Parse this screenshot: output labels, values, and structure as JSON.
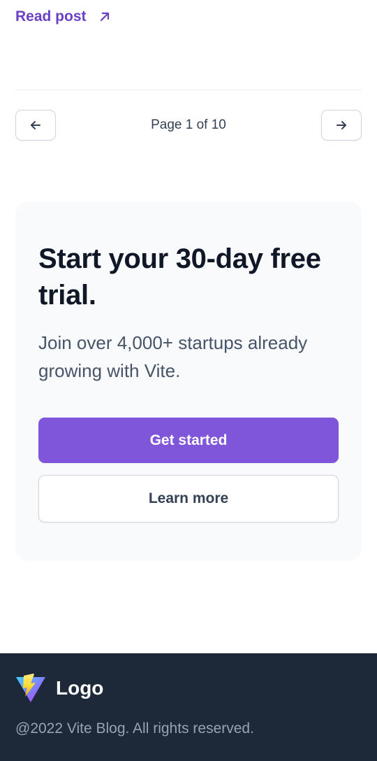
{
  "blog": {
    "read_post_label": "Read post"
  },
  "pagination": {
    "indicator": "Page 1 of 10",
    "prev_icon": "arrow-left-icon",
    "next_icon": "arrow-right-icon"
  },
  "cta": {
    "title": "Start your 30-day free trial.",
    "subtitle": "Join over 4,000+ startups already growing with Vite.",
    "primary_label": "Get started",
    "secondary_label": "Learn more"
  },
  "footer": {
    "logo_text": "Logo",
    "logo_icon": "vite-logo-icon",
    "copyright": "@2022 Vite Blog. All rights reserved."
  },
  "colors": {
    "accent": "#7F56D9",
    "link": "#6941C6",
    "footer_bg": "#1D2939",
    "card_bg": "#F9FAFB"
  }
}
